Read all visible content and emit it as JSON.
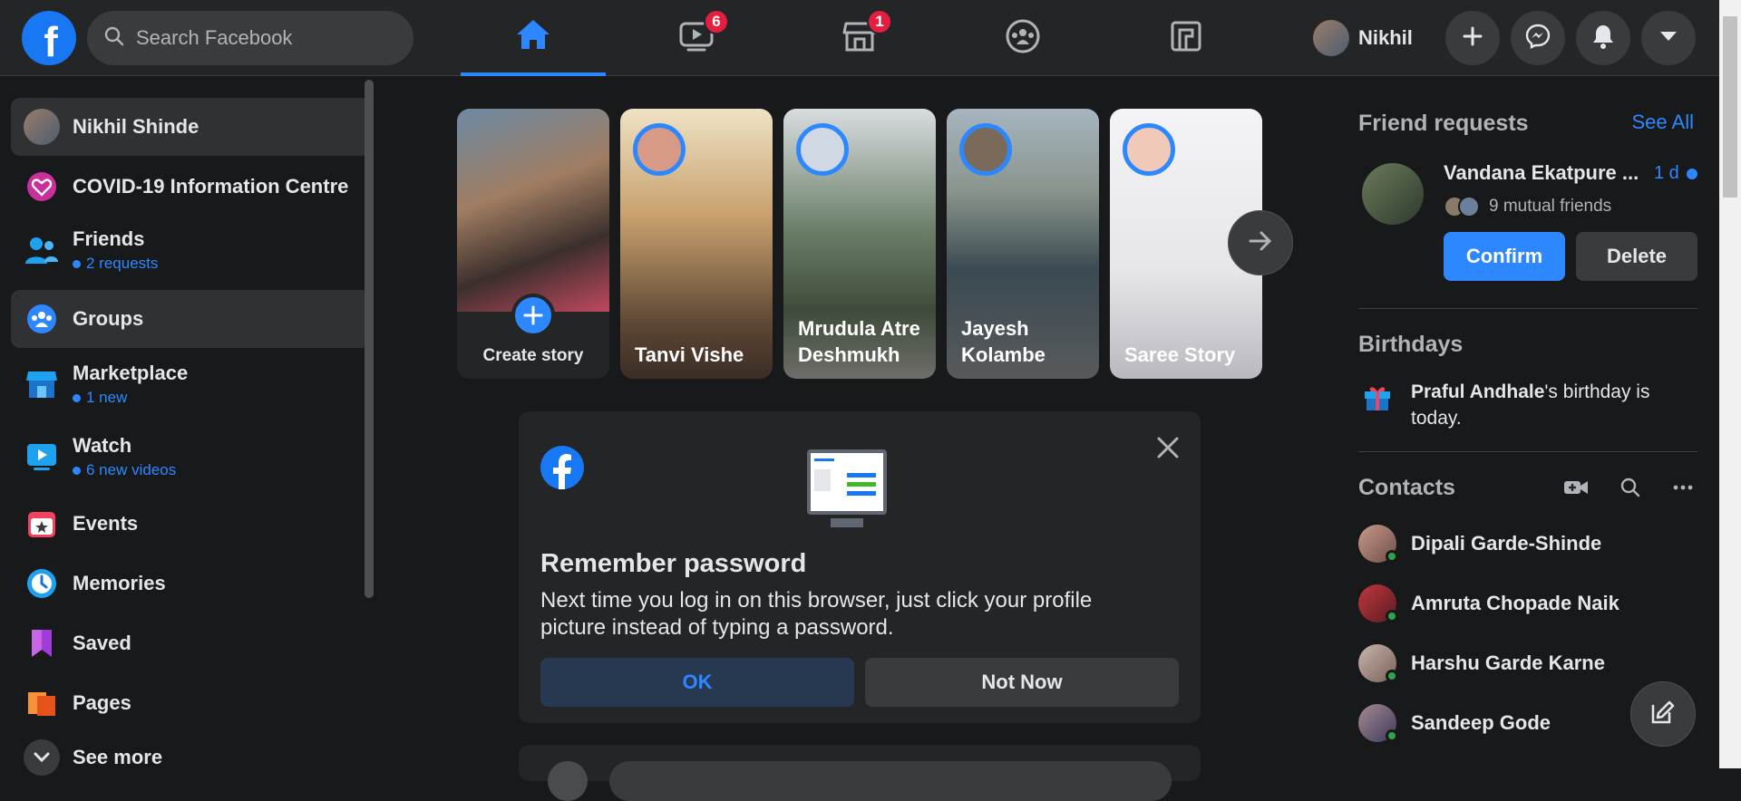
{
  "header": {
    "logo": "f",
    "search_placeholder": "Search Facebook",
    "tabs": [
      {
        "name": "home",
        "badge": ""
      },
      {
        "name": "watch",
        "badge": "6"
      },
      {
        "name": "marketplace",
        "badge": "1"
      },
      {
        "name": "groups",
        "badge": ""
      },
      {
        "name": "gaming",
        "badge": ""
      }
    ],
    "profile_name": "Nikhil",
    "accent": "#2d88ff"
  },
  "sidebar": {
    "items": [
      {
        "label": "Nikhil Shinde",
        "sub": ""
      },
      {
        "label": "COVID-19 Information Centre",
        "sub": ""
      },
      {
        "label": "Friends",
        "sub": "2 requests"
      },
      {
        "label": "Groups",
        "sub": ""
      },
      {
        "label": "Marketplace",
        "sub": "1 new"
      },
      {
        "label": "Watch",
        "sub": "6 new videos"
      },
      {
        "label": "Events",
        "sub": ""
      },
      {
        "label": "Memories",
        "sub": ""
      },
      {
        "label": "Saved",
        "sub": ""
      },
      {
        "label": "Pages",
        "sub": ""
      },
      {
        "label": "See more",
        "sub": ""
      }
    ]
  },
  "stories": [
    {
      "name": "Create story"
    },
    {
      "name": "Tanvi Vishe"
    },
    {
      "name": "Mrudula Atre Deshmukh"
    },
    {
      "name": "Jayesh Kolambe"
    },
    {
      "name": "Saree Story"
    }
  ],
  "remember_card": {
    "title": "Remember password",
    "body": "Next time you log in on this browser, just click your profile picture instead of typing a password.",
    "ok_label": "OK",
    "not_now_label": "Not Now"
  },
  "right": {
    "friend_requests_title": "Friend requests",
    "see_all": "See All",
    "request_name": "Vandana Ekatpure ...",
    "request_time": "1 d",
    "mutual": "9 mutual friends",
    "confirm_label": "Confirm",
    "delete_label": "Delete",
    "birthdays_title": "Birthdays",
    "birthday_name": "Praful Andhale",
    "birthday_text": "'s birthday is today.",
    "contacts_title": "Contacts",
    "contacts": [
      {
        "name": "Dipali Garde-Shinde"
      },
      {
        "name": "Amruta Chopade Naik"
      },
      {
        "name": "Harshu Garde Karne"
      },
      {
        "name": "Sandeep Gode"
      }
    ]
  }
}
